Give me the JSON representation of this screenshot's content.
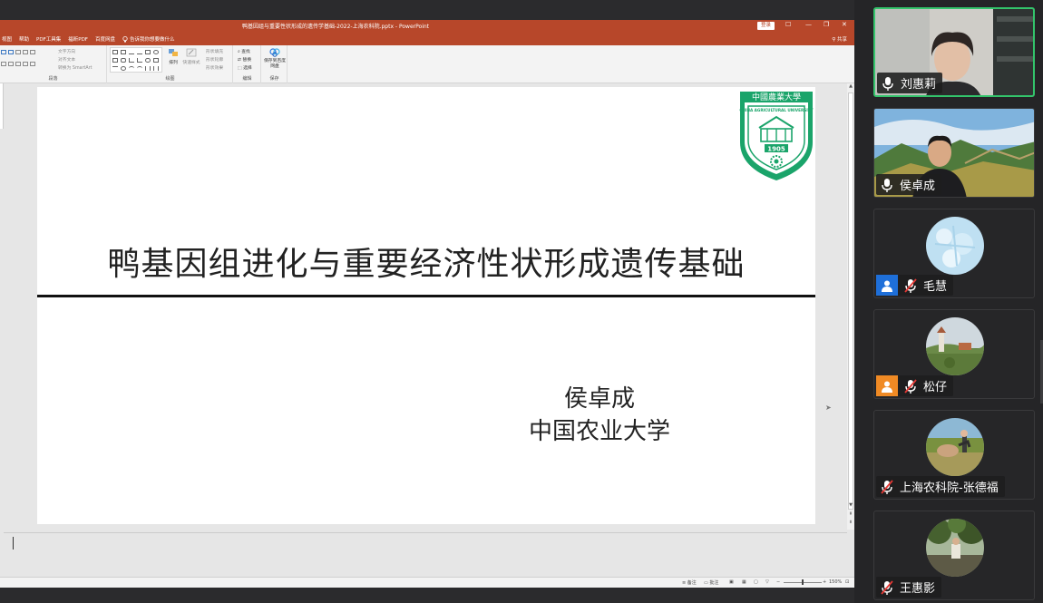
{
  "window": {
    "title": "鸭基因组与重要性状形成的遗传学基础-2022-上海农科院.pptx - PowerPoint",
    "login_label": "登录",
    "controls": [
      "☐",
      "—",
      "❐",
      "✕"
    ]
  },
  "menu": {
    "tabs": [
      "视图",
      "帮助",
      "PDF工具集",
      "福昕PDF",
      "百度网盘"
    ],
    "tell_me": "告诉我你想要做什么",
    "share": "共享"
  },
  "ribbon": {
    "paragraph_group": "段落",
    "drawing_group": "绘图",
    "editing_group": "编辑",
    "save_group": "保存",
    "text_direction": "文字方向",
    "align_text": "对齐文本",
    "convert_smartart": "转换为 SmartArt",
    "arrange": "排列",
    "quick_styles": "快速样式",
    "shape_fill": "形状填充",
    "shape_outline": "形状轮廓",
    "shape_effects": "形状效果",
    "find": "查找",
    "replace": "替换",
    "select": "选择",
    "save_to_baidu": "保存到百度网盘"
  },
  "slide": {
    "title": "鸭基因组进化与重要经济性状形成遗传基础",
    "author": "侯卓成",
    "affiliation": "中国农业大学",
    "logo": {
      "top_text": "中國農業大學",
      "ring_text": "CHINA AGRICULTURAL UNIVERSITY",
      "year": "1905"
    }
  },
  "statusbar": {
    "notes": "备注",
    "comments": "批注",
    "zoom": "150%"
  },
  "participants": [
    {
      "name": "刘惠莉",
      "mic": "on",
      "video": true,
      "active": true,
      "scene": "room"
    },
    {
      "name": "侯卓成",
      "mic": "on",
      "video": true,
      "active": false,
      "scene": "greatwall"
    },
    {
      "name": "毛慧",
      "mic": "muted",
      "video": false,
      "active": false,
      "scene": "frost",
      "user_icon": "blue"
    },
    {
      "name": "松仔",
      "mic": "muted",
      "video": false,
      "active": false,
      "scene": "tower",
      "user_icon": "orange"
    },
    {
      "name": "上海农科院-张德福",
      "mic": "muted",
      "video": false,
      "active": false,
      "scene": "field"
    },
    {
      "name": "王惠影",
      "mic": "muted",
      "video": false,
      "active": false,
      "scene": "forest"
    }
  ],
  "colors": {
    "ppt_accent": "#b7472a",
    "active_speaker": "#33c46b",
    "logo_green": "#1aa46a",
    "user_blue": "#1e6fd9",
    "user_orange": "#f08a24"
  }
}
